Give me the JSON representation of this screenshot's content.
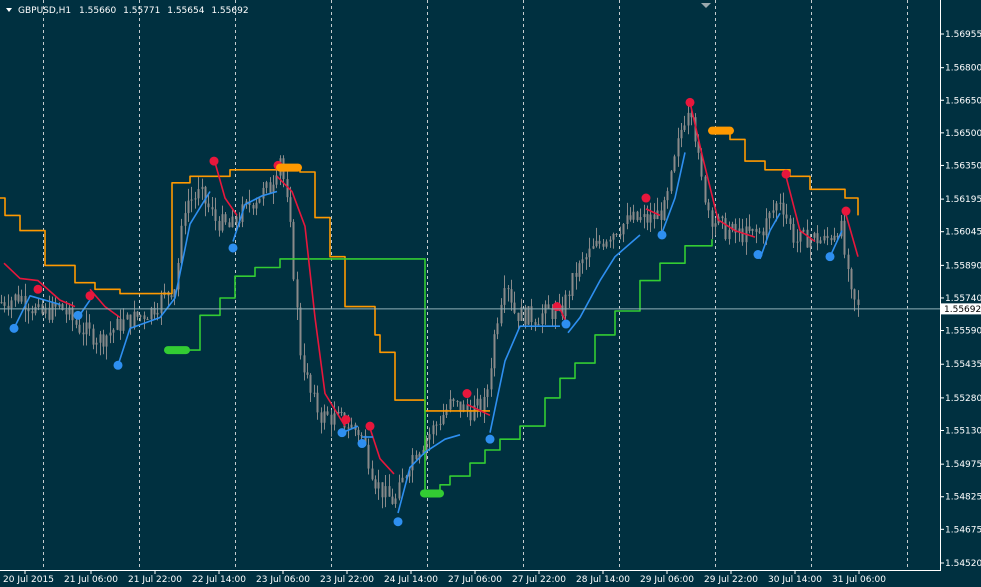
{
  "header": {
    "symbol": "GBPUSD,H1",
    "open": "1.55660",
    "high": "1.55771",
    "low": "1.55654",
    "close": "1.55692"
  },
  "current_price": "1.55692",
  "colors": {
    "background": "#003040",
    "grid": "#e8e8e8",
    "candle": "#8a8a8a",
    "upper_stop": "#ff9900",
    "lower_stop": "#33cc33",
    "falling_ma": "#e8173c",
    "rising_ma": "#2e8ff0",
    "price_line": "#8fb0b8"
  },
  "chart_data": {
    "type": "candlestick",
    "symbol": "GBPUSD",
    "timeframe": "H1",
    "ylim": [
      1.5452,
      1.5707
    ],
    "y_ticks": [
      "1.56955",
      "1.56800",
      "1.56650",
      "1.56500",
      "1.56350",
      "1.56195",
      "1.56045",
      "1.55890",
      "1.55740",
      "1.55590",
      "1.55435",
      "1.55280",
      "1.55130",
      "1.54975",
      "1.54825",
      "1.54675",
      "1.54520"
    ],
    "x_ticks": [
      "20 Jul 2015",
      "21 Jul 06:00",
      "21 Jul 22:00",
      "22 Jul 14:00",
      "23 Jul 06:00",
      "23 Jul 22:00",
      "24 Jul 14:00",
      "27 Jul 06:00",
      "27 Jul 22:00",
      "28 Jul 14:00",
      "29 Jul 06:00",
      "29 Jul 22:00",
      "30 Jul 14:00",
      "31 Jul 06:00"
    ],
    "last_price": 1.55692,
    "upper_stop_line": [
      [
        0,
        1.562
      ],
      [
        5,
        1.5612
      ],
      [
        20,
        1.5605
      ],
      [
        45,
        1.5589
      ],
      [
        75,
        1.5581
      ],
      [
        95,
        1.5578
      ],
      [
        120,
        1.5576
      ],
      [
        170,
        1.5576
      ],
      [
        172,
        1.5627
      ],
      [
        190,
        1.563
      ],
      [
        230,
        1.5633
      ],
      [
        280,
        1.5633
      ],
      [
        300,
        1.5632
      ],
      [
        315,
        1.5611
      ],
      [
        330,
        1.5593
      ],
      [
        345,
        1.557
      ],
      [
        360,
        1.557
      ],
      [
        375,
        1.5557
      ],
      [
        380,
        1.5549
      ],
      [
        395,
        1.5527
      ],
      [
        410,
        1.5527
      ],
      [
        425,
        1.5522
      ],
      [
        490,
        1.5522
      ]
    ],
    "upper_stop_line_2": [
      [
        712,
        1.5651
      ],
      [
        730,
        1.5647
      ],
      [
        745,
        1.5637
      ],
      [
        765,
        1.5633
      ],
      [
        790,
        1.563
      ],
      [
        810,
        1.5624
      ],
      [
        845,
        1.562
      ],
      [
        858,
        1.5612
      ]
    ],
    "lower_stop_line": [
      [
        168,
        1.555
      ],
      [
        185,
        1.555
      ],
      [
        200,
        1.5566
      ],
      [
        220,
        1.5574
      ],
      [
        235,
        1.5584
      ],
      [
        255,
        1.5588
      ],
      [
        280,
        1.5592
      ],
      [
        425,
        1.5485
      ],
      [
        440,
        1.5488
      ],
      [
        450,
        1.5492
      ],
      [
        470,
        1.5498
      ],
      [
        485,
        1.5504
      ],
      [
        500,
        1.5509
      ],
      [
        520,
        1.5515
      ],
      [
        545,
        1.5528
      ],
      [
        560,
        1.5537
      ],
      [
        575,
        1.5544
      ],
      [
        595,
        1.5557
      ],
      [
        615,
        1.5568
      ],
      [
        640,
        1.5582
      ],
      [
        660,
        1.559
      ],
      [
        685,
        1.5598
      ],
      [
        712,
        1.5601
      ]
    ],
    "falling_ma": [
      [
        [
          4,
          1.559
        ],
        [
          20,
          1.5583
        ],
        [
          38,
          1.5582
        ],
        [
          60,
          1.5573
        ],
        [
          75,
          1.557
        ]
      ],
      [
        [
          90,
          1.5578
        ],
        [
          105,
          1.557
        ],
        [
          120,
          1.5565
        ]
      ],
      [
        [
          214,
          1.5638
        ],
        [
          225,
          1.562
        ],
        [
          237,
          1.5612
        ]
      ],
      [
        [
          277,
          1.563
        ],
        [
          292,
          1.5623
        ],
        [
          305,
          1.5607
        ],
        [
          315,
          1.5565
        ],
        [
          325,
          1.553
        ],
        [
          345,
          1.5515
        ]
      ],
      [
        [
          370,
          1.5514
        ],
        [
          380,
          1.55
        ],
        [
          394,
          1.5493
        ]
      ],
      [
        [
          467,
          1.5525
        ],
        [
          490,
          1.552
        ]
      ],
      [
        [
          557,
          1.5572
        ],
        [
          567,
          1.5562
        ]
      ],
      [
        [
          646,
          1.5615
        ],
        [
          660,
          1.5612
        ]
      ],
      [
        [
          690,
          1.5664
        ],
        [
          702,
          1.564
        ],
        [
          718,
          1.561
        ],
        [
          735,
          1.5605
        ],
        [
          755,
          1.5602
        ]
      ],
      [
        [
          786,
          1.563
        ],
        [
          800,
          1.5605
        ],
        [
          815,
          1.56
        ]
      ],
      [
        [
          845,
          1.5614
        ],
        [
          858,
          1.5593
        ]
      ]
    ],
    "rising_ma": [
      [
        [
          14,
          1.556
        ],
        [
          30,
          1.5575
        ],
        [
          45,
          1.5573
        ],
        [
          60,
          1.5571
        ]
      ],
      [
        [
          78,
          1.5565
        ],
        [
          90,
          1.5573
        ]
      ],
      [
        [
          118,
          1.5543
        ],
        [
          130,
          1.556
        ],
        [
          160,
          1.5565
        ],
        [
          175,
          1.5574
        ],
        [
          190,
          1.5608
        ],
        [
          210,
          1.5623
        ]
      ],
      [
        [
          233,
          1.56
        ],
        [
          245,
          1.5617
        ],
        [
          262,
          1.5621
        ],
        [
          277,
          1.5623
        ]
      ],
      [
        [
          342,
          1.5512
        ],
        [
          358,
          1.5515
        ]
      ],
      [
        [
          362,
          1.551
        ],
        [
          373,
          1.551
        ]
      ],
      [
        [
          398,
          1.5475
        ],
        [
          410,
          1.5496
        ],
        [
          425,
          1.5503
        ],
        [
          445,
          1.5509
        ],
        [
          460,
          1.5511
        ]
      ],
      [
        [
          490,
          1.5512
        ],
        [
          505,
          1.5545
        ],
        [
          520,
          1.5561
        ],
        [
          560,
          1.5561
        ]
      ],
      [
        [
          568,
          1.5558
        ],
        [
          580,
          1.5565
        ],
        [
          600,
          1.5582
        ],
        [
          615,
          1.5593
        ],
        [
          640,
          1.5603
        ]
      ],
      [
        [
          662,
          1.5604
        ],
        [
          675,
          1.562
        ],
        [
          685,
          1.5641
        ]
      ],
      [
        [
          760,
          1.5592
        ],
        [
          770,
          1.5605
        ],
        [
          780,
          1.5613
        ]
      ],
      [
        [
          830,
          1.5593
        ],
        [
          842,
          1.5605
        ]
      ]
    ],
    "falling_dots": [
      [
        38,
        1.5578
      ],
      [
        90,
        1.5575
      ],
      [
        214,
        1.5637
      ],
      [
        278,
        1.5635
      ],
      [
        346,
        1.5518
      ],
      [
        370,
        1.5515
      ],
      [
        467,
        1.553
      ],
      [
        557,
        1.557
      ],
      [
        646,
        1.562
      ],
      [
        690,
        1.5664
      ],
      [
        786,
        1.5631
      ],
      [
        846,
        1.5614
      ]
    ],
    "rising_dots": [
      [
        14,
        1.556
      ],
      [
        78,
        1.5566
      ],
      [
        118,
        1.5543
      ],
      [
        233,
        1.5597
      ],
      [
        342,
        1.5512
      ],
      [
        362,
        1.5507
      ],
      [
        398,
        1.5471
      ],
      [
        490,
        1.5509
      ],
      [
        566,
        1.5562
      ],
      [
        662,
        1.5603
      ],
      [
        758,
        1.5594
      ],
      [
        830,
        1.5593
      ]
    ],
    "stop_markers": [
      [
        {
          "x": 168,
          "y": 1.555
        },
        {
          "x": 186,
          "y": 1.555
        }
      ],
      [
        {
          "x": 424,
          "y": 1.5484
        },
        {
          "x": 440,
          "y": 1.5484
        }
      ],
      [
        {
          "x": 280,
          "y": 1.5634
        },
        {
          "x": 298,
          "y": 1.5634
        }
      ],
      [
        {
          "x": 712,
          "y": 1.5651
        },
        {
          "x": 730,
          "y": 1.5651
        }
      ]
    ]
  }
}
